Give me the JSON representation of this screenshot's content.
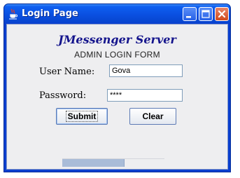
{
  "window": {
    "title": "Login Page",
    "title_bar_color": "#0a4fe0"
  },
  "form": {
    "heading": "JMessenger Server",
    "subheading": "ADMIN LOGIN FORM",
    "username_label": "User Name:",
    "username_value": "Gova",
    "password_label": "Password:",
    "password_value": "****",
    "submit_label": "Submit",
    "clear_label": "Clear",
    "heading_color": "#14148c"
  },
  "progress": {
    "fraction": 0.6
  },
  "icons": {
    "app": "java-cup-icon",
    "minimize": "minimize-icon",
    "maximize": "maximize-icon",
    "close": "close-icon"
  }
}
